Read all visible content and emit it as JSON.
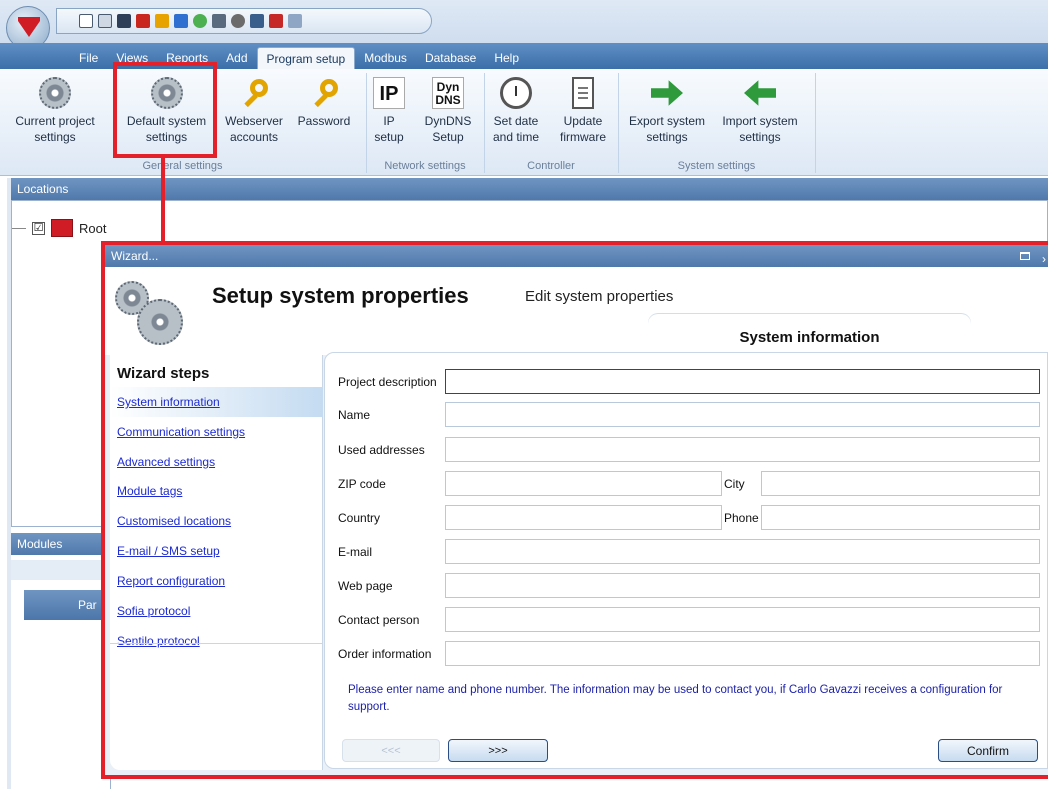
{
  "menu": {
    "tabs": [
      "File",
      "Views",
      "Reports",
      "Add",
      "Program setup",
      "Modbus",
      "Database",
      "Help"
    ],
    "active": "Program setup"
  },
  "ribbon": {
    "buttons": [
      {
        "label1": "Current project",
        "label2": "settings",
        "icon": "gears-icon"
      },
      {
        "label1": "Default system",
        "label2": "settings",
        "icon": "gears-icon"
      },
      {
        "label1": "Webserver",
        "label2": "accounts",
        "icon": "key-icon"
      },
      {
        "label1": "Password",
        "label2": "",
        "icon": "key-icon"
      },
      {
        "label1": "IP",
        "label2": "setup",
        "icon": "ip-icon"
      },
      {
        "label1": "DynDNS",
        "label2": "Setup",
        "icon": "dyndns-icon"
      },
      {
        "label1": "Set date",
        "label2": "and time",
        "icon": "alarm-clock-icon"
      },
      {
        "label1": "Update",
        "label2": "firmware",
        "icon": "document-icon"
      },
      {
        "label1": "Export system",
        "label2": "settings",
        "icon": "export-arrow-icon"
      },
      {
        "label1": "Import system",
        "label2": "settings",
        "icon": "import-arrow-icon"
      }
    ],
    "groups": [
      "General settings",
      "Network settings",
      "Controller",
      "System settings"
    ],
    "ip_icon_text": "IP",
    "dyn_icon_line1": "Dyn",
    "dyn_icon_line2": "DNS"
  },
  "locations": {
    "header": "Locations",
    "root_label": "Root",
    "root_checked": "☑"
  },
  "modules": {
    "header": "Modules",
    "column": "Par"
  },
  "wizard": {
    "window_title": "Wizard...",
    "heading": "Setup system properties",
    "subheading": "Edit system properties",
    "active_tab": "System information",
    "steps_title": "Wizard steps",
    "steps": [
      "System information",
      "Communication settings",
      "Advanced settings",
      "Module tags",
      "Customised locations",
      "E-mail / SMS setup",
      "Report configuration",
      "Sofia protocol",
      "Sentilo protocol"
    ],
    "active_step": "System information",
    "fields": {
      "project_description": {
        "label": "Project description",
        "value": ""
      },
      "name": {
        "label": "Name",
        "value": ""
      },
      "used_addresses": {
        "label": "Used addresses",
        "value": ""
      },
      "zip_code": {
        "label": "ZIP code",
        "value": ""
      },
      "city": {
        "label": "City",
        "value": ""
      },
      "country": {
        "label": "Country",
        "value": ""
      },
      "phone": {
        "label": "Phone",
        "value": ""
      },
      "email": {
        "label": "E-mail",
        "value": ""
      },
      "web_page": {
        "label": "Web page",
        "value": ""
      },
      "contact_person": {
        "label": "Contact person",
        "value": ""
      },
      "order_information": {
        "label": "Order information",
        "value": ""
      }
    },
    "info_text": "Please enter name and phone number. The information may be used to contact you, if Carlo Gavazzi receives a configuration for support.",
    "buttons": {
      "back": "<<<",
      "next": ">>>",
      "confirm": "Confirm"
    }
  },
  "colors": {
    "highlight": "#e4202a",
    "header_blue": "#5079ab",
    "link": "#1d2bd1",
    "info_text": "#1a1fa8"
  }
}
